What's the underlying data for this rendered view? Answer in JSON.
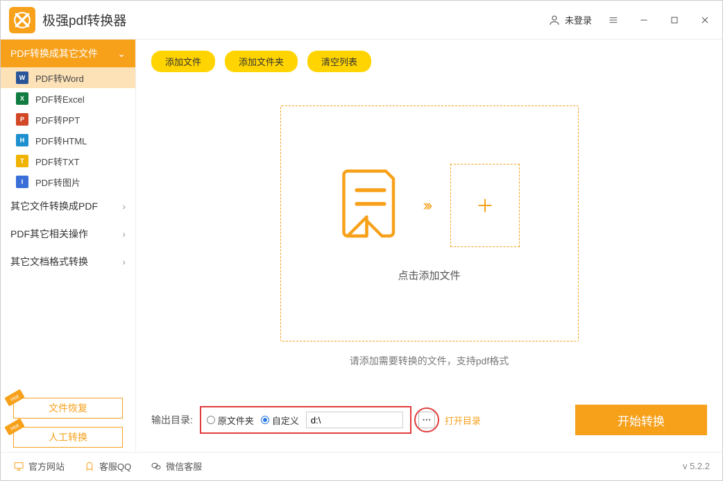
{
  "app": {
    "title": "极强pdf转换器",
    "login_text": "未登录"
  },
  "sidebar": {
    "cat1": "PDF转换成其它文件",
    "cat2": "其它文件转换成PDF",
    "cat3": "PDF其它相关操作",
    "cat4": "其它文档格式转换",
    "items": [
      {
        "label": "PDF转Word",
        "icon": "W",
        "bg": "#2a5699"
      },
      {
        "label": "PDF转Excel",
        "icon": "X",
        "bg": "#107c41"
      },
      {
        "label": "PDF转PPT",
        "icon": "P",
        "bg": "#d24726"
      },
      {
        "label": "PDF转HTML",
        "icon": "H",
        "bg": "#1e90cf"
      },
      {
        "label": "PDF转TXT",
        "icon": "T",
        "bg": "#f0b400"
      },
      {
        "label": "PDF转图片",
        "icon": "I",
        "bg": "#3a6fd8"
      }
    ],
    "hot1": "文件恢复",
    "hot2": "人工转换",
    "hot_label": "Hot"
  },
  "toolbar": {
    "add_file": "添加文件",
    "add_folder": "添加文件夹",
    "clear": "清空列表"
  },
  "drop": {
    "click_text": "点击添加文件",
    "hint": "请添加需要转换的文件，支持pdf格式"
  },
  "output": {
    "label": "输出目录:",
    "radio_orig": "原文件夹",
    "radio_custom": "自定义",
    "path": "d:\\",
    "open_dir": "打开目录",
    "start": "开始转换"
  },
  "footer": {
    "site": "官方网站",
    "qq": "客服QQ",
    "wechat": "微信客服",
    "version": "v 5.2.2"
  }
}
